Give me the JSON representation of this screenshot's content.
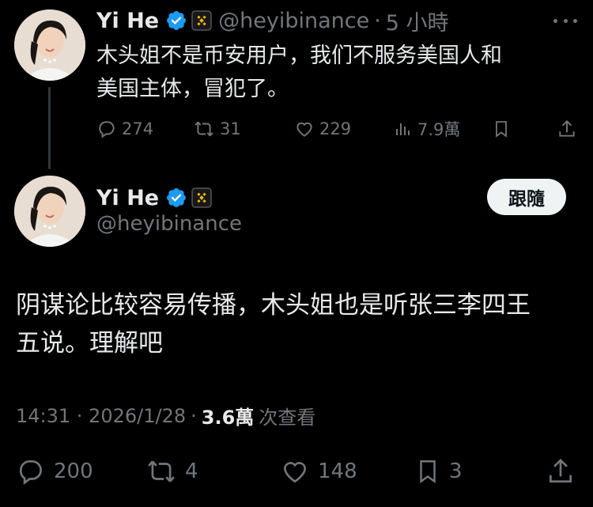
{
  "tweet1": {
    "author_name": "Yi He",
    "handle": "@heyibinance",
    "separator": "·",
    "time": "5 小時",
    "text_line1": "木头姐不是币安用户，我们不服务美国人和",
    "text_line2": "美国主体，冒犯了。",
    "replies": "274",
    "reposts": "31",
    "likes": "229",
    "views": "7.9萬"
  },
  "tweet2": {
    "author_name": "Yi He",
    "handle": "@heyibinance",
    "follow_label": "跟隨",
    "text_line1": "阴谋论比较容易传播，木头姐也是听张三李四王",
    "text_line2": "五说。理解吧",
    "timestamp": "14:31 · 2026/1/28",
    "meta_sep": "·",
    "views_count": "3.6萬",
    "views_label": "次查看",
    "replies": "200",
    "reposts": "4",
    "likes": "148",
    "bookmarks": "3"
  },
  "colors": {
    "background": "#000000",
    "text": "#e7e9ea",
    "muted": "#71767b",
    "verified": "#1d9bf0",
    "binance_gold": "#f0b90b"
  },
  "icons": [
    "verified-badge-icon",
    "binance-affiliate-icon",
    "more-icon",
    "reply-icon",
    "repost-icon",
    "like-icon",
    "views-icon",
    "bookmark-icon",
    "share-icon"
  ]
}
